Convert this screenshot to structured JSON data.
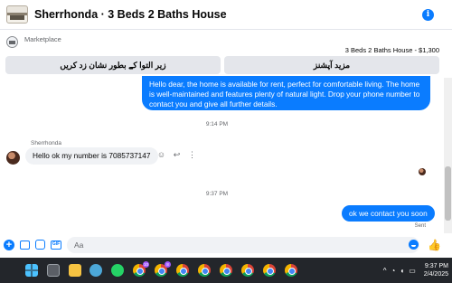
{
  "header": {
    "title": "Sherrhonda · 3 Beds 2 Baths House",
    "info_glyph": "i"
  },
  "marketplace": {
    "label": "Marketplace",
    "listing_summary": "3 Beds 2 Baths House - $1,300"
  },
  "actions": {
    "more_options": "مزید آپشنز",
    "mark_pending": "زیر التوا کے بطور نشان زد کریں"
  },
  "messages": {
    "first_outgoing": "Hello dear, the home is available for rent, perfect for comfortable living. The home is well-maintained and features plenty of natural light. Drop your phone number to contact you and give all further details.",
    "time_1": "9:14 PM",
    "sender_name": "Sherrhonda",
    "incoming": "Hello ok my number is 7085737147",
    "time_2": "9:37 PM",
    "reply": "ok we contact you soon",
    "status": "Sent"
  },
  "composer": {
    "placeholder": "Aa",
    "plus_glyph": "+",
    "gif_glyph": "GIF",
    "like_glyph": "👍"
  },
  "reaction_glyphs": {
    "emoji": "☺",
    "reply": "↩",
    "more": "⋮"
  },
  "taskbar": {
    "badge_1": "10",
    "badge_2": "8",
    "tray_glyphs": {
      "chevron": "^",
      "wifi": "◔",
      "volume": "◖",
      "battery": "▭"
    }
  },
  "clock": {
    "time": "9:37 PM",
    "date": "2/4/2025"
  },
  "colors": {
    "accent": "#0a7cff",
    "bubble_in": "#f0f2f5",
    "taskbar": "#23262b"
  }
}
